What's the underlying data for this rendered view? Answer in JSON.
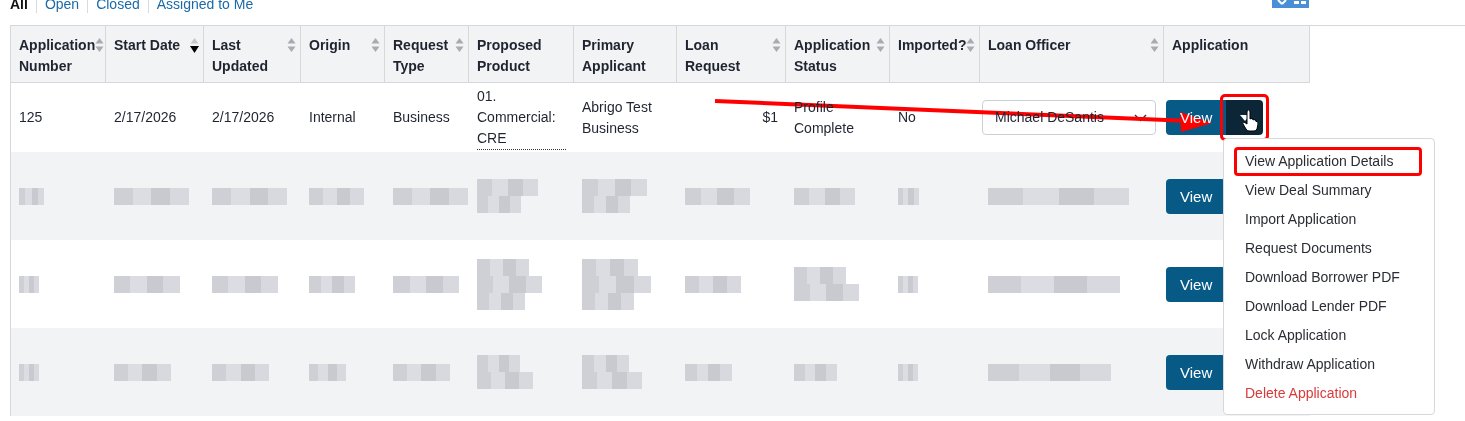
{
  "tabs": [
    {
      "label": "All",
      "selected": true
    },
    {
      "label": "Open",
      "selected": false
    },
    {
      "label": "Closed",
      "selected": false
    },
    {
      "label": "Assigned to Me",
      "selected": false
    }
  ],
  "table": {
    "columns": [
      {
        "label": "Application Number",
        "sortable": true,
        "sorted_descending": false
      },
      {
        "label": "Start Date",
        "sortable": true,
        "sorted_descending": true
      },
      {
        "label": "Last Updated",
        "sortable": true,
        "sorted_descending": false
      },
      {
        "label": "Origin",
        "sortable": true,
        "sorted_descending": false
      },
      {
        "label": "Request Type",
        "sortable": true,
        "sorted_descending": false
      },
      {
        "label": "Proposed Product",
        "sortable": false
      },
      {
        "label": "Primary Applicant",
        "sortable": false
      },
      {
        "label": "Loan Request",
        "sortable": true,
        "sorted_descending": false
      },
      {
        "label": "Application Status",
        "sortable": true,
        "sorted_descending": false
      },
      {
        "label": "Imported?",
        "sortable": true,
        "sorted_descending": false
      },
      {
        "label": "Loan Officer",
        "sortable": true,
        "sorted_descending": false
      },
      {
        "label": "Application",
        "sortable": false
      }
    ],
    "rows": [
      {
        "kind": "data",
        "application_number": "125",
        "start_date": "2/17/2026",
        "last_updated": "2/17/2026",
        "origin": "Internal",
        "request_type": "Business",
        "proposed_product": "01. Commercial: CRE",
        "primary_applicant": "Abrigo Test Business",
        "loan_request": "$1",
        "application_status": "Profile Complete",
        "imported": "No",
        "loan_officer": "Michael DeSantis",
        "view_button": "View",
        "caret_highlighted": true
      },
      {
        "kind": "redacted",
        "view_button": "View"
      },
      {
        "kind": "redacted",
        "view_button": "View"
      },
      {
        "kind": "redacted",
        "view_button": "View"
      }
    ]
  },
  "menu": {
    "items": [
      {
        "label": "View Application Details",
        "danger": false,
        "highlighted": true
      },
      {
        "label": "View Deal Summary",
        "danger": false,
        "highlighted": false
      },
      {
        "label": "Import Application",
        "danger": false,
        "highlighted": false
      },
      {
        "label": "Request Documents",
        "danger": false,
        "highlighted": false
      },
      {
        "label": "Download Borrower PDF",
        "danger": false,
        "highlighted": false
      },
      {
        "label": "Download Lender PDF",
        "danger": false,
        "highlighted": false
      },
      {
        "label": "Lock Application",
        "danger": false,
        "highlighted": false
      },
      {
        "label": "Withdraw Application",
        "danger": false,
        "highlighted": false
      },
      {
        "label": "Delete Application",
        "danger": true,
        "highlighted": false
      }
    ]
  },
  "annotation_arrow": true
}
